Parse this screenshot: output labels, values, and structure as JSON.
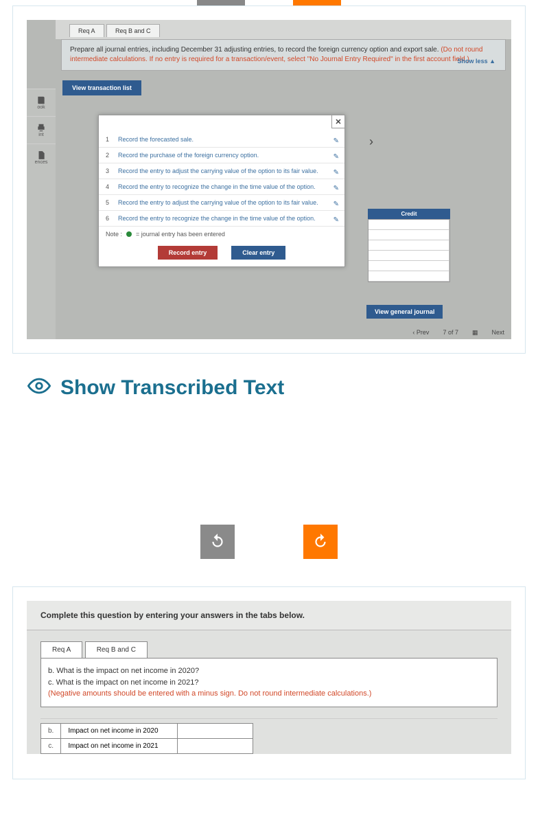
{
  "tabs_top": {
    "a": "Req A",
    "bc": "Req B and C"
  },
  "instructions": {
    "main": "Prepare all journal entries, including December 31 adjusting entries, to record the foreign currency option and export sale.",
    "red": "(Do not round intermediate calculations. If no entry is required for a transaction/event, select \"No Journal Entry Required\" in the first account field.)",
    "show_less": "Show less ▲"
  },
  "view_trans": "View transaction list",
  "sidebar": [
    {
      "label": "ook"
    },
    {
      "label": "int"
    },
    {
      "label": "ences"
    }
  ],
  "modal_rows": [
    {
      "n": "1",
      "t": "Record the forecasted sale."
    },
    {
      "n": "2",
      "t": "Record the purchase of the foreign currency option."
    },
    {
      "n": "3",
      "t": "Record the entry to adjust the carrying value of the option to its fair value."
    },
    {
      "n": "4",
      "t": "Record the entry to recognize the change in the time value of the option."
    },
    {
      "n": "5",
      "t": "Record the entry to adjust the carrying value of the option to its fair value."
    },
    {
      "n": "6",
      "t": "Record the entry to recognize the change in the time value of the option."
    }
  ],
  "note": "= journal entry has been entered",
  "note_prefix": "Note :",
  "record_btn": "Record entry",
  "clear_btn": "Clear entry",
  "credit_hdr": "Credit",
  "view_gen": "View general journal",
  "arrow": "›",
  "close": "✕",
  "footer": {
    "prev": "‹  Prev",
    "page": "7  of  7",
    "next": "Next"
  },
  "show_transcribed": "Show Transcribed Text",
  "complete": "Complete this question by entering your answers in the tabs below.",
  "tabs2": {
    "a": "Req A",
    "bc": "Req B and C"
  },
  "bc": {
    "l1": "b. What is the impact on net income in 2020?",
    "l2": "c. What is the impact on net income in 2021?",
    "red": "(Negative amounts should be entered with a minus sign. Do not round intermediate calculations.)"
  },
  "ans": [
    {
      "l": "b.",
      "t": "Impact on net income in 2020"
    },
    {
      "l": "c.",
      "t": "Impact on net income in 2021"
    }
  ]
}
